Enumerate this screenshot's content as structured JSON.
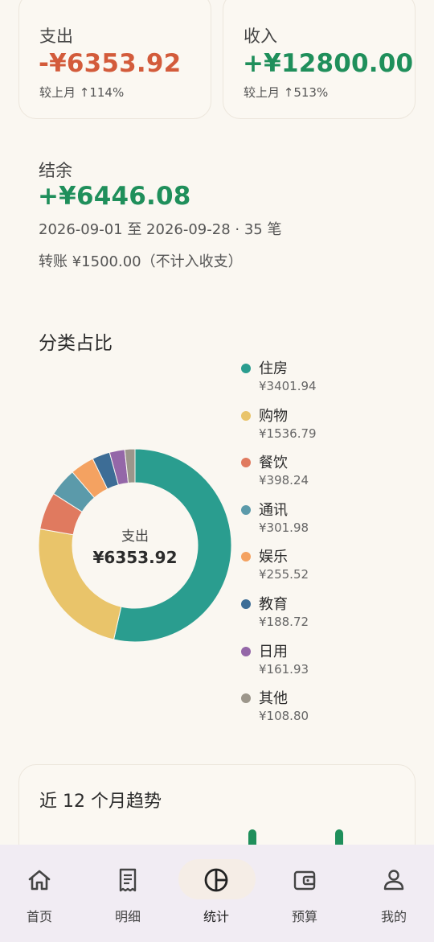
{
  "summary": {
    "expense": {
      "label": "支出",
      "value": "-¥6353.92",
      "compare": "较上月 ↑114%"
    },
    "income": {
      "label": "收入",
      "value": "+¥12800.00",
      "compare": "较上月 ↑513%"
    },
    "balance": {
      "label": "结余",
      "value": "+¥6446.08",
      "range": "2026-09-01 至 2026-09-28 · 35 笔",
      "transfer": "转账 ¥1500.00（不计入收支）"
    }
  },
  "category": {
    "title": "分类占比",
    "center_label": "支出",
    "center_value": "¥6353.92",
    "items": [
      {
        "name": "住房",
        "amount": "¥3401.94",
        "value": 3401.94,
        "color": "#2a9d8f"
      },
      {
        "name": "购物",
        "amount": "¥1536.79",
        "value": 1536.79,
        "color": "#e9c46a"
      },
      {
        "name": "餐饮",
        "amount": "¥398.24",
        "value": 398.24,
        "color": "#e07a5f"
      },
      {
        "name": "通讯",
        "amount": "¥301.98",
        "value": 301.98,
        "color": "#5b9aaa"
      },
      {
        "name": "娱乐",
        "amount": "¥255.52",
        "value": 255.52,
        "color": "#f4a261"
      },
      {
        "name": "教育",
        "amount": "¥188.72",
        "value": 188.72,
        "color": "#3d6d96"
      },
      {
        "name": "日用",
        "amount": "¥161.93",
        "value": 161.93,
        "color": "#9467a8"
      },
      {
        "name": "其他",
        "amount": "¥108.80",
        "value": 108.8,
        "color": "#9c968b"
      }
    ]
  },
  "trend": {
    "title": "近 12 个月趋势"
  },
  "chart_data": {
    "type": "pie",
    "categories": [
      "住房",
      "购物",
      "餐饮",
      "通讯",
      "娱乐",
      "教育",
      "日用",
      "其他"
    ],
    "values": [
      3401.94,
      1536.79,
      398.24,
      301.98,
      255.52,
      188.72,
      161.93,
      108.8
    ],
    "title": "分类占比"
  },
  "nav": {
    "active": "统计",
    "items": [
      {
        "label": "首页",
        "icon": "home-icon"
      },
      {
        "label": "明细",
        "icon": "receipt-icon"
      },
      {
        "label": "统计",
        "icon": "pie-chart-icon"
      },
      {
        "label": "预算",
        "icon": "wallet-icon"
      },
      {
        "label": "我的",
        "icon": "person-icon"
      }
    ]
  }
}
